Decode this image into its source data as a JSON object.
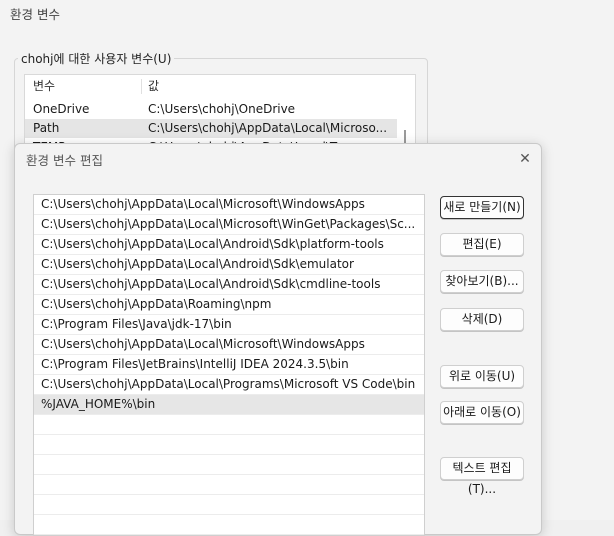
{
  "background_window": {
    "title": "환경 변수",
    "user_vars_group_label": "chohj에 대한 사용자 변수(U)",
    "columns": [
      "변수",
      "값"
    ],
    "rows": [
      {
        "name": "OneDrive",
        "value": "C:\\Users\\chohj\\OneDrive"
      },
      {
        "name": "Path",
        "value": "C:\\Users\\chohj\\AppData\\Local\\Microso..."
      },
      {
        "name": "TEMP",
        "value": "C:\\Users\\chohj\\AppData\\Local\\Temp"
      }
    ]
  },
  "dialog": {
    "title": "환경 변수 편집",
    "close_glyph": "✕",
    "paths": [
      "C:\\Users\\chohj\\AppData\\Local\\Microsoft\\WindowsApps",
      "C:\\Users\\chohj\\AppData\\Local\\Microsoft\\WinGet\\Packages\\Sc...",
      "C:\\Users\\chohj\\AppData\\Local\\Android\\Sdk\\platform-tools",
      "C:\\Users\\chohj\\AppData\\Local\\Android\\Sdk\\emulator",
      "C:\\Users\\chohj\\AppData\\Local\\Android\\Sdk\\cmdline-tools",
      "C:\\Users\\chohj\\AppData\\Roaming\\npm",
      "C:\\Program Files\\Java\\jdk-17\\bin",
      "C:\\Users\\chohj\\AppData\\Local\\Microsoft\\WindowsApps",
      "C:\\Program Files\\JetBrains\\IntelliJ IDEA 2024.3.5\\bin",
      "C:\\Users\\chohj\\AppData\\Local\\Programs\\Microsoft VS Code\\bin",
      "%JAVA_HOME%\\bin"
    ],
    "selected_path_index": 10,
    "buttons": {
      "new": "새로 만들기(N)",
      "edit": "편집(E)",
      "browse": "찾아보기(B)...",
      "delete": "삭제(D)",
      "move_up": "위로 이동(U)",
      "move_down": "아래로 이동(O)",
      "edit_text": "텍스트 편집(T)..."
    }
  }
}
